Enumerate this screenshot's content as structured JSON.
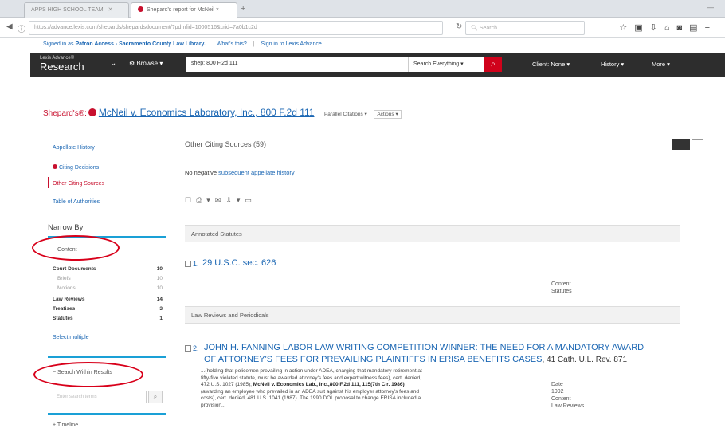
{
  "browser": {
    "tabs": [
      {
        "label": "APPS HIGH SCHOOL TEAM"
      },
      {
        "label": "Shepard's report for McNeil ×"
      }
    ],
    "url": "https://advance.lexis.com/shepards/shepardsdocument/?pdmfid=1000516&crid=7a0b1c2d",
    "url_domain": "advance.lexis.com",
    "search_placeholder": "Search"
  },
  "patron": {
    "prefix": "Signed in as",
    "name": "Patron Access - Sacramento County Law Library.",
    "whats_this": "What's this?",
    "sign_in": "Sign in to Lexis Advance"
  },
  "header": {
    "brand_small": "Lexis Advance®",
    "brand_big": "Research",
    "browse": "Browse",
    "query": "shep: 800 F.2d 111",
    "search_scope": "Search Everything",
    "client": "Client: None",
    "history": "History",
    "more": "More"
  },
  "shepard": {
    "label": "Shepard's®:",
    "case": "McNeil v. Economics Laboratory, Inc., 800 F.2d 111",
    "parallel": "Parallel Citations",
    "actions": "Actions"
  },
  "sidebar": {
    "links": [
      "Appellate History",
      "Citing Decisions",
      "Other Citing Sources",
      "Table of Authorities"
    ],
    "narrow_by": "Narrow By",
    "content_hd": "Content",
    "facets": [
      {
        "label": "Court Documents",
        "count": "10"
      },
      {
        "label": "Briefs",
        "count": "10"
      },
      {
        "label": "Motions",
        "count": "10"
      },
      {
        "label": "Law Reviews",
        "count": "14"
      },
      {
        "label": "Treatises",
        "count": "3"
      },
      {
        "label": "Statutes",
        "count": "1"
      }
    ],
    "select_multiple": "Select multiple",
    "search_within": "Search Within Results",
    "search_within_placeholder": "Enter search terms",
    "timeline": "Timeline"
  },
  "main": {
    "title": "Other Citing Sources (59)",
    "no_negative": "No negative",
    "history_link": "subsequent appellate history",
    "groups": [
      "Annotated Statutes",
      "Law Reviews and Periodicals"
    ],
    "result1": {
      "num": "1.",
      "title": "29 U.S.C. sec. 626",
      "content_label": "Content",
      "content_value": "Statutes"
    },
    "result2": {
      "num": "2.",
      "title_line1": "JOHN H. FANNING LABOR LAW WRITING COMPETITION WINNER: THE NEED FOR A MANDATORY AWARD",
      "title_line2": "OF ATTORNEY'S FEES FOR PREVAILING PLAINTIFFS IN ERISA BENEFITS CASES",
      "cite": ", 41 Cath. U.L. Rev. 871",
      "snippet1": "...(holding that policemen prevailing in action under ADEA, charging that mandatory retirement at",
      "snippet2": "fifty-five violated statute, must be awarded attorney's fees and expert witness fees), cert. denied,",
      "snippet3a": "472 U.S. 1027 (1985);",
      "snippet3b": "McNeil v. Economics Lab., Inc.,800 F.2d 111, 115(7th Cir. 1986)",
      "snippet4": "(awarding an employee who prevailed in an ADEA suit against his employer attorney's fees and",
      "snippet5": "costs), cert. denied, 481 U.S. 1041 (1987). The 1990 DOL proposal to change ERISA included a",
      "snippet6": "provision...",
      "date_label": "Date",
      "date_value": "1992",
      "content_label": "Content",
      "content_value": "Law Reviews"
    }
  },
  "colors": {
    "accent_red": "#c8102e",
    "link_blue": "#1a66b3",
    "bar_dark": "#2d2d2d",
    "annotation_red": "#d8001a"
  }
}
